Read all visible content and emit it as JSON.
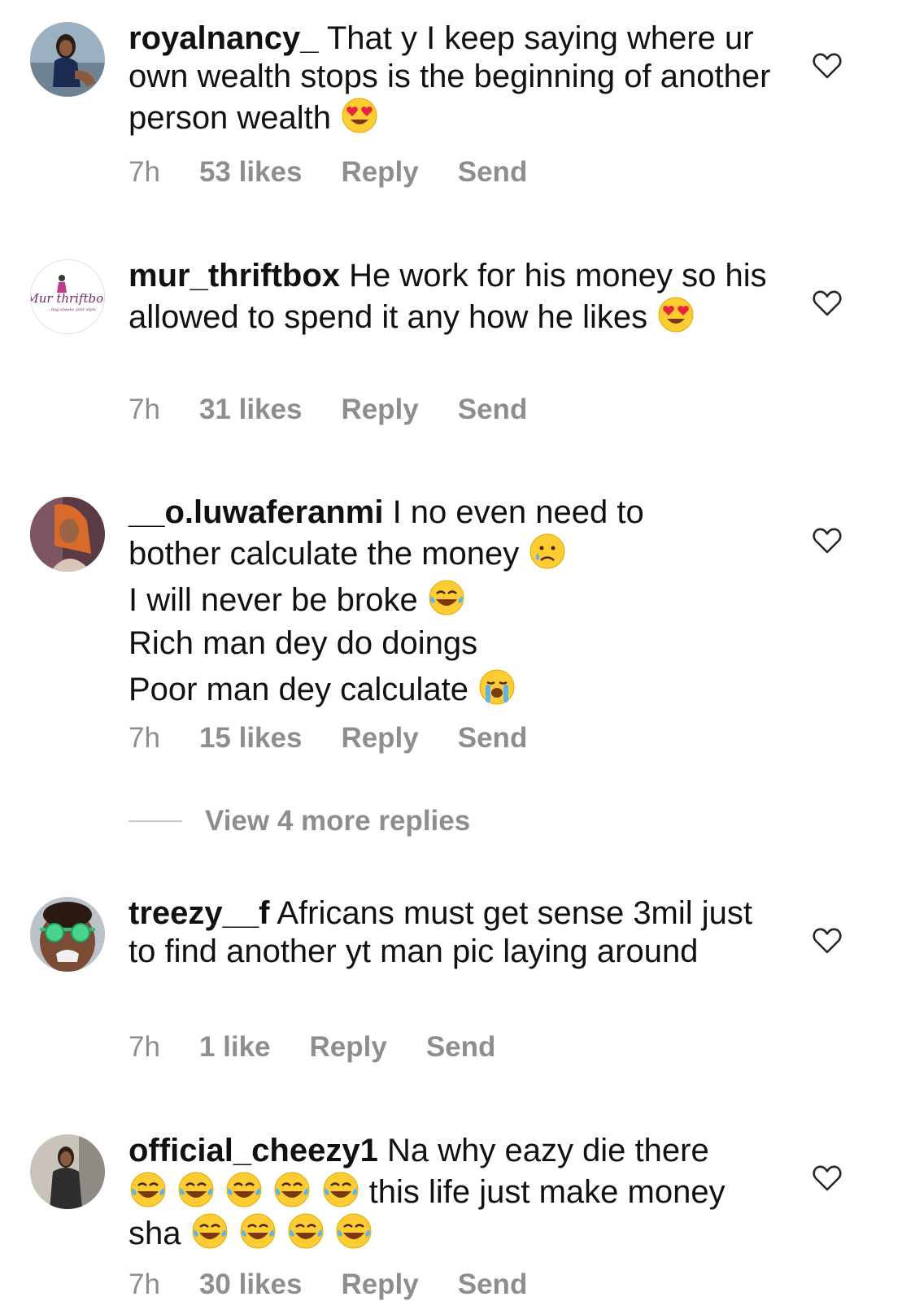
{
  "comments": [
    {
      "username": "royalnancy_",
      "text": "That y I keep saying where ur own wealth stops is the beginning of another person wealth",
      "time": "7h",
      "likes": "53 likes",
      "reply": "Reply",
      "send": "Send"
    },
    {
      "username": "mur_thriftbox",
      "avatar_text": "Mur thriftbox",
      "avatar_tagline": "...bag speaks your style",
      "text": "He work for his money so his allowed to spend it any how he likes",
      "time": "7h",
      "likes": "31 likes",
      "reply": "Reply",
      "send": "Send"
    },
    {
      "username": "__o.luwaferanmi",
      "lines": [
        "I no even need to",
        "bother calculate the money",
        "I will never be broke",
        "Rich man dey do doings",
        "Poor man dey calculate"
      ],
      "time": "7h",
      "likes": "15 likes",
      "reply": "Reply",
      "send": "Send",
      "view_more": "View 4 more replies"
    },
    {
      "username": "treezy__f",
      "text": "Africans must get sense 3mil just to find another yt man pic laying around",
      "time": "7h",
      "likes": "1 like",
      "reply": "Reply",
      "send": "Send"
    },
    {
      "username": "official_cheezy1",
      "text1": "Na why eazy die there",
      "text2": "this life just make money",
      "text3": "sha",
      "time": "7h",
      "likes": "30 likes",
      "reply": "Reply",
      "send": "Send"
    }
  ],
  "colors": {
    "meta_gray": "#8e8e8e",
    "text": "#111111",
    "divider": "#c7c7c7"
  },
  "icons": {
    "like": "heart-icon",
    "emoji": [
      "heart-eyes",
      "sad-tear",
      "laughing-tears",
      "loudly-crying"
    ]
  }
}
